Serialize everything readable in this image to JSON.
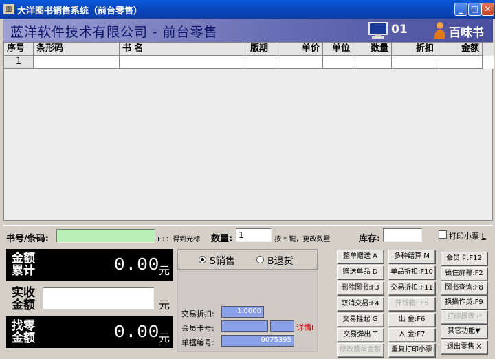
{
  "window": {
    "title": "大洋图书销售系统（前台零售）",
    "icon": "book-stack-icon"
  },
  "header": {
    "company": "蓝洋软件技术有限公司 - 前台零售",
    "terminal_no": "01",
    "cashier": "百味书"
  },
  "grid": {
    "columns": [
      "序号",
      "条形码",
      "书 名",
      "版期",
      "单价",
      "单位",
      "数量",
      "折扣",
      "金额"
    ],
    "rows": [
      [
        "1",
        "",
        "",
        "",
        "",
        "",
        "",
        "",
        ""
      ]
    ]
  },
  "inputbar": {
    "barcode_label": "书号/条码:",
    "barcode_value": "",
    "barcode_hint": "F1：得到光标",
    "qty_label": "数量:",
    "qty_value": "1",
    "qty_hint": "按 * 键，更改数量",
    "stock_label": "库存:",
    "stock_value": "",
    "print_label": "打印小票",
    "print_key": "L",
    "print_checked": false
  },
  "totals": {
    "sum_label1": "金额",
    "sum_label2": "累计",
    "sum_value": "0.00",
    "paid_label1": "实收",
    "paid_label2": "金额",
    "paid_value": "",
    "change_label1": "找零",
    "change_label2": "金额",
    "change_value": "0.00",
    "unit": "元"
  },
  "mode": {
    "sale_key": "S",
    "sale_label": "销售",
    "return_key": "B",
    "return_label": "退货",
    "selected": "sale"
  },
  "info": {
    "discount_label": "交易折扣:",
    "discount_value": "1.0000",
    "member_label": "会员卡号:",
    "member_value": "",
    "member_value2": "",
    "detail_link": "详情I",
    "doc_label": "单据编号:",
    "doc_value": "0075395"
  },
  "buttons": {
    "col1": [
      "整单赠送 A",
      "赠送单品 D",
      "删除图书:F3",
      "取消交易:F4",
      "交易挂起 G",
      "交易弹出 T",
      "修改整单金额"
    ],
    "col2": [
      "多种结算 M",
      "单品折扣:F10",
      "交易折扣:F11",
      "开钱箱: F5",
      "出  金:F6",
      "入  金:F7",
      "重复打印小票"
    ],
    "col3": [
      "会员卡:F12",
      "锁住屏幕:F2",
      "图书查询:F8",
      "换操作员:F9",
      "打印报表 P",
      "其它功能▼",
      "退出零售 X"
    ],
    "disabled": [
      "修改整单金额",
      "开钱箱: F5",
      "打印报表 P"
    ]
  }
}
